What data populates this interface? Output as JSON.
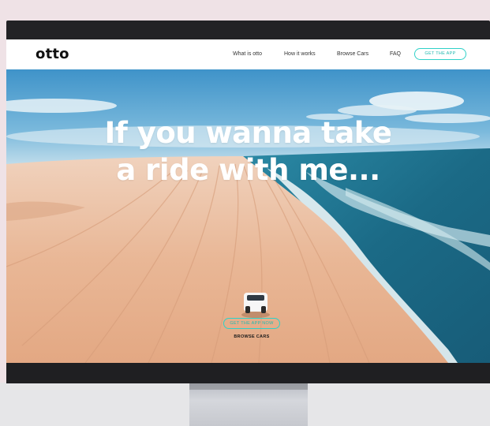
{
  "site": {
    "logo": "otto"
  },
  "nav": {
    "items": [
      {
        "label": "What is otto"
      },
      {
        "label": "How it works"
      },
      {
        "label": "Browse Cars"
      },
      {
        "label": "FAQ"
      }
    ],
    "cta_label": "GET THE APP"
  },
  "hero": {
    "headline_line1": "If you wanna take",
    "headline_line2": "a ride with me...",
    "primary_cta": "GET THE APP NOW",
    "secondary_cta": "BROWSE CARS"
  },
  "colors": {
    "accent": "#2fd1c8",
    "sand": "#e8b99a",
    "ocean": "#1d6d86",
    "sky": "#4fa3d1",
    "frame": "#222225"
  }
}
